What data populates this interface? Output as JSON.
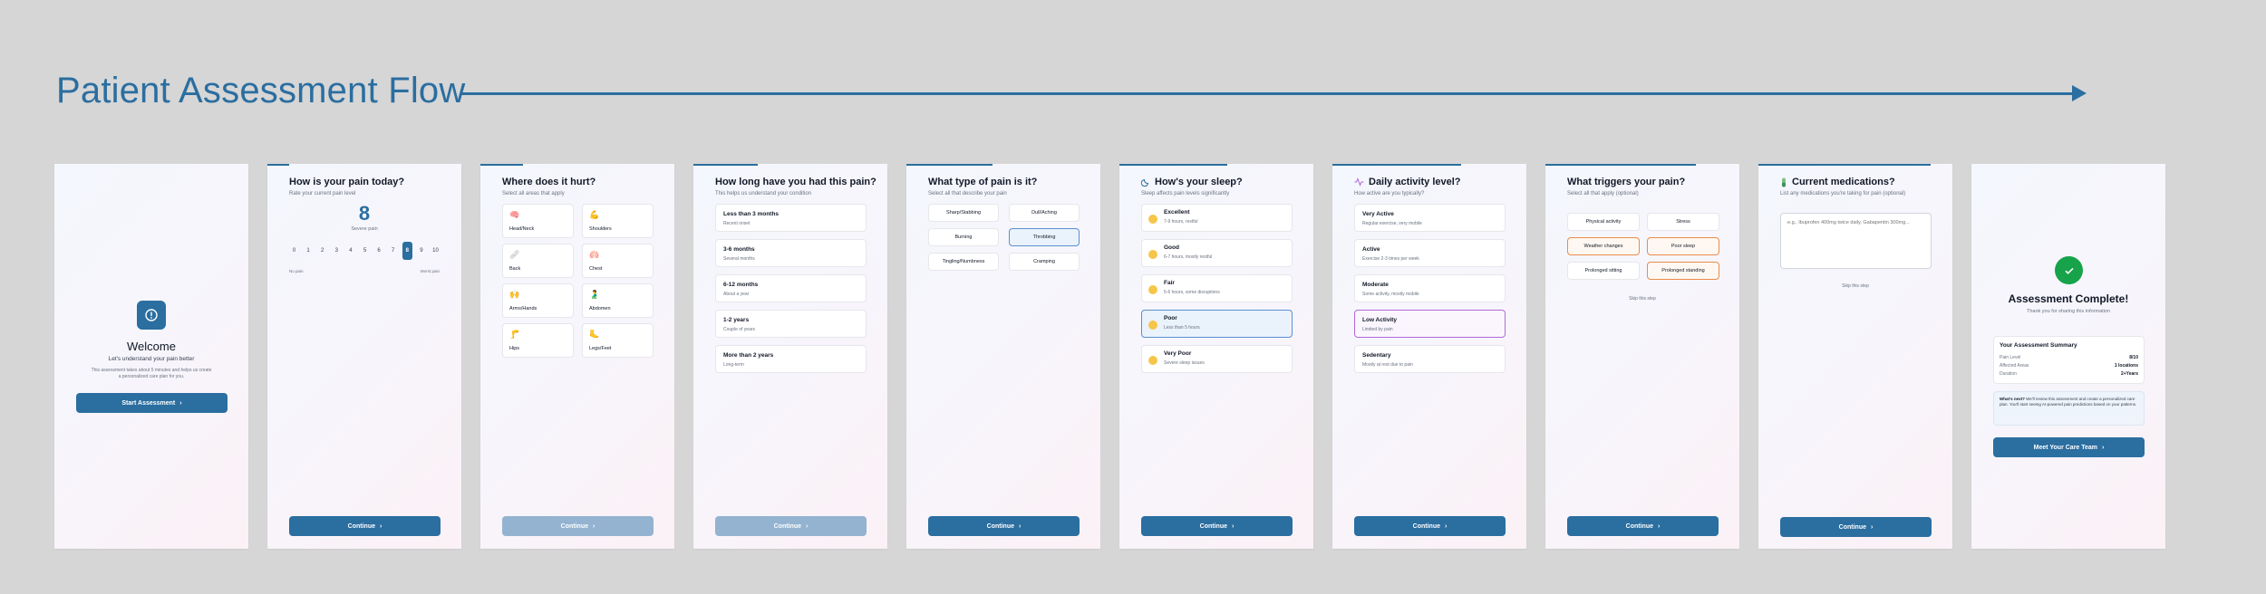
{
  "flow": {
    "title": "Patient Assessment Flow"
  },
  "welcome": {
    "heading": "Welcome",
    "subtitle": "Let's understand your pain better",
    "description_1": "This assessment takes about 5 minutes and helps us create",
    "description_2": "a personalized care plan for you.",
    "button": "Start Assessment",
    "info_icon": "info-icon"
  },
  "pain_level": {
    "heading": "How is your pain today?",
    "sub": "Rate your current pain level",
    "value": "8",
    "value_label": "Severe pain",
    "scale": [
      "0",
      "1",
      "2",
      "3",
      "4",
      "5",
      "6",
      "7",
      "8",
      "9",
      "10"
    ],
    "selected_index": 8,
    "min_label": "No pain",
    "max_label": "Worst pain",
    "button": "Continue"
  },
  "location": {
    "heading": "Where does it hurt?",
    "sub": "Select all areas that apply",
    "areas": [
      {
        "icon": "🧠",
        "label": "Head/Neck"
      },
      {
        "icon": "💪",
        "label": "Shoulders"
      },
      {
        "icon": "🩹",
        "label": "Back"
      },
      {
        "icon": "🫁",
        "label": "Chest"
      },
      {
        "icon": "🙌",
        "label": "Arms/Hands"
      },
      {
        "icon": "🫃",
        "label": "Abdomen"
      },
      {
        "icon": "🦵",
        "label": "Hips"
      },
      {
        "icon": "🦶",
        "label": "Legs/Feet"
      }
    ],
    "button": "Continue"
  },
  "duration": {
    "heading": "How long have you had this pain?",
    "sub": "This helps us understand your condition",
    "options": [
      {
        "title": "Less than 3 months",
        "desc": "Recent onset"
      },
      {
        "title": "3-6 months",
        "desc": "Several months"
      },
      {
        "title": "6-12 months",
        "desc": "About a year"
      },
      {
        "title": "1-2 years",
        "desc": "Couple of years"
      },
      {
        "title": "More than 2 years",
        "desc": "Long-term"
      }
    ],
    "button": "Continue"
  },
  "pain_type": {
    "heading": "What type of pain is it?",
    "sub": "Select all that describe your pain",
    "types": [
      "Sharp/Stabbing",
      "Dull/Aching",
      "Burning",
      "Throbbing",
      "Tingling/Numbness",
      "Cramping"
    ],
    "selected_index": 3,
    "button": "Continue"
  },
  "sleep": {
    "heading": "How's your sleep?",
    "sub": "Sleep affects pain levels significantly",
    "icon": "moon-icon",
    "options": [
      {
        "title": "Excellent",
        "desc": "7-9 hours, restful"
      },
      {
        "title": "Good",
        "desc": "6-7 hours, mostly restful"
      },
      {
        "title": "Fair",
        "desc": "5-6 hours, some disruptions"
      },
      {
        "title": "Poor",
        "desc": "Less than 5 hours"
      },
      {
        "title": "Very Poor",
        "desc": "Severe sleep issues"
      }
    ],
    "selected_index": 3,
    "button": "Continue"
  },
  "activity": {
    "heading": "Daily activity level?",
    "sub": "How active are you typically?",
    "icon": "activity-icon",
    "options": [
      {
        "title": "Very Active",
        "desc": "Regular exercise, very mobile"
      },
      {
        "title": "Active",
        "desc": "Exercise 2-3 times per week"
      },
      {
        "title": "Moderate",
        "desc": "Some activity, mostly mobile"
      },
      {
        "title": "Low Activity",
        "desc": "Limited by pain"
      },
      {
        "title": "Sedentary",
        "desc": "Mostly at rest due to pain"
      }
    ],
    "selected_index": 3,
    "button": "Continue"
  },
  "triggers": {
    "heading": "What triggers your pain?",
    "sub": "Select all that apply (optional)",
    "items": [
      "Physical activity",
      "Stress",
      "Weather changes",
      "Poor sleep",
      "Prolonged sitting",
      "Prolonged standing"
    ],
    "selected": [
      2,
      3,
      5
    ],
    "skip": "Skip this step",
    "button": "Continue"
  },
  "medications": {
    "heading": "Current medications?",
    "sub": "List any medications you're taking for pain (optional)",
    "icon": "pill-icon",
    "placeholder": "e.g., Ibuprofen 400mg twice daily, Gabapentin 300mg...",
    "skip": "Skip this step",
    "button": "Continue"
  },
  "complete": {
    "heading": "Assessment Complete!",
    "sub": "Thank you for sharing this information",
    "summary_title": "Your Assessment Summary",
    "summary": [
      {
        "label": "Pain Level",
        "value": "8/10"
      },
      {
        "label": "Affected Areas",
        "value": "1 locations"
      },
      {
        "label": "Duration",
        "value": "2+Years"
      }
    ],
    "whats_next_label": "What's next?",
    "whats_next_text": "We'll review this assessment and create a personalized care plan. You'll start seeing AI-powered pain predictions based on your patterns.",
    "button": "Meet Your Care Team"
  },
  "colors": {
    "primary": "#2b6ea0",
    "selected_blue": "#5b8fd0",
    "selected_orange": "#ea8c4a",
    "selected_purple": "#b06ad8",
    "success": "#16a34a"
  }
}
